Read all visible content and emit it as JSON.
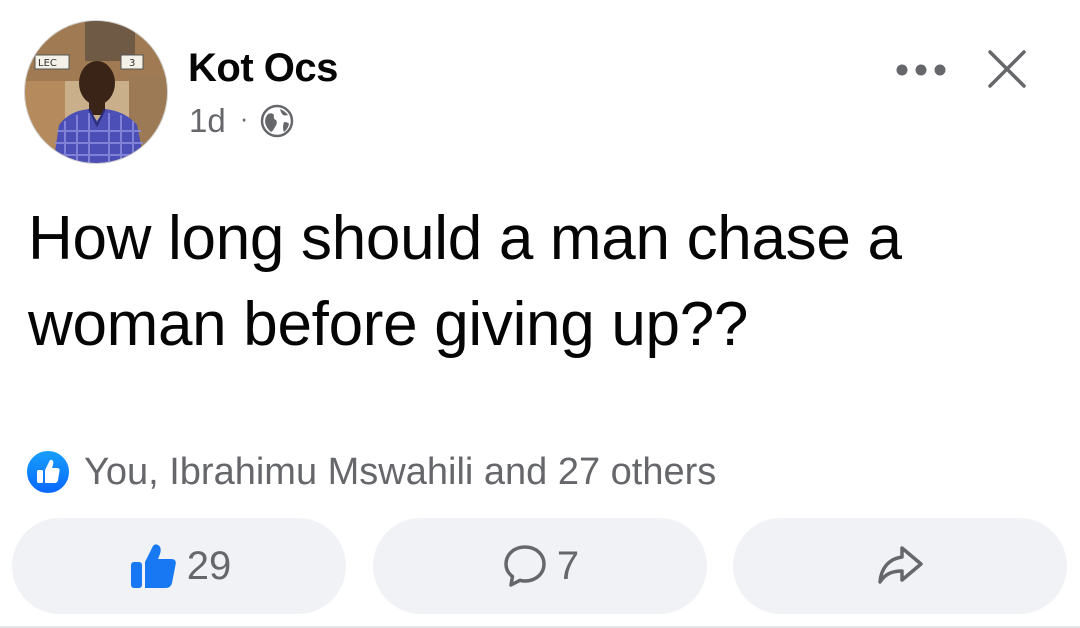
{
  "post": {
    "author": "Kot Ocs",
    "time": "1d",
    "separator": "·",
    "privacy_icon": "globe-icon",
    "text": "How long should a man chase a woman before giving up??",
    "reactions_summary": "You, Ibrahimu Mswahili and 27 others",
    "reaction_icon": "like-icon",
    "avatar_sign_text": [
      "LEC",
      "3"
    ]
  },
  "actions": {
    "like_count": "29",
    "comment_count": "7",
    "share_icon": "share-arrow-icon"
  },
  "colors": {
    "accent": "#1877f2",
    "secondary_text": "#65676b",
    "button_bg": "#f0f2f5"
  }
}
